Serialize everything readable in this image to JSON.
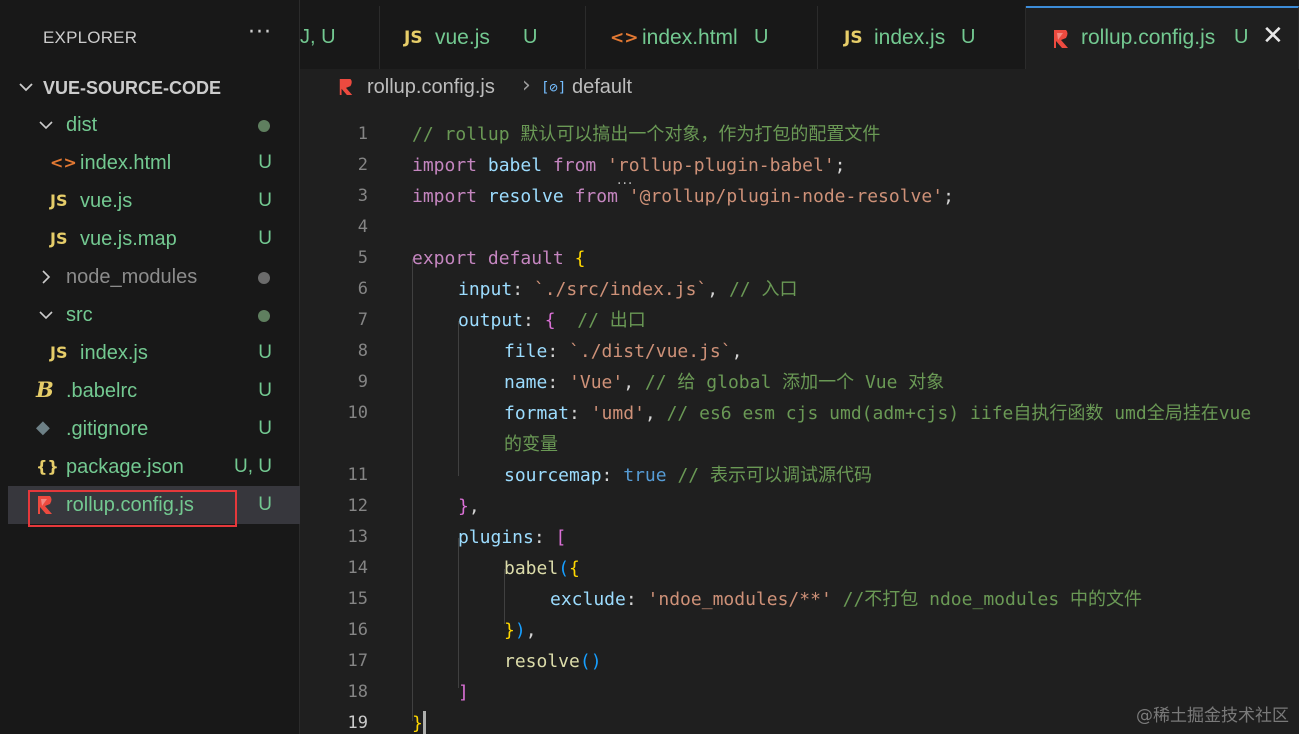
{
  "sidebar": {
    "title": "EXPLORER",
    "more": "···",
    "root": "VUE-SOURCE-CODE",
    "items": [
      {
        "label": "dist",
        "status": ""
      },
      {
        "label": "index.html",
        "status": "U",
        "icon": "<>"
      },
      {
        "label": "vue.js",
        "status": "U",
        "icon": "JS"
      },
      {
        "label": "vue.js.map",
        "status": "U",
        "icon": "JS"
      },
      {
        "label": "node_modules",
        "status": ""
      },
      {
        "label": "src",
        "status": ""
      },
      {
        "label": "index.js",
        "status": "U",
        "icon": "JS"
      },
      {
        "label": ".babelrc",
        "status": "U",
        "icon": "B"
      },
      {
        "label": ".gitignore",
        "status": "U",
        "icon": "◆"
      },
      {
        "label": "package.json",
        "status": "U, U",
        "icon": "{}"
      },
      {
        "label": "rollup.config.js",
        "status": "U",
        "icon": "rollup"
      }
    ]
  },
  "tabs": [
    {
      "label": "",
      "status": "J, U"
    },
    {
      "label": "vue.js",
      "status": "U",
      "icon": "JS"
    },
    {
      "label": "index.html",
      "status": "U",
      "icon": "<>"
    },
    {
      "label": "index.js",
      "status": "U",
      "icon": "JS"
    },
    {
      "label": "rollup.config.js",
      "status": "U",
      "close": "✕"
    }
  ],
  "breadcrumb": {
    "file": "rollup.config.js",
    "separator": "›",
    "symbol_icon": "[⊘]",
    "symbol": "default"
  },
  "editor": {
    "line_numbers": [
      "1",
      "2",
      "3",
      "4",
      "5",
      "6",
      "7",
      "8",
      "9",
      "10",
      "11",
      "12",
      "13",
      "14",
      "15",
      "16",
      "17",
      "18",
      "19"
    ],
    "current_line": "19",
    "lines": {
      "l1": {
        "comment": "// rollup 默认可以搞出一个对象，作为打包的配置文件"
      },
      "l2": {
        "kw1": "import",
        "id": " babel ",
        "kw2": "from",
        "sp": " ",
        "str": "'rollup-plugin-babel'",
        "end": ";"
      },
      "l3": {
        "kw1": "import",
        "id": " resolve ",
        "kw2": "from",
        "sp": " ",
        "str": "'@rollup/plugin-node-resolve'",
        "end": ";"
      },
      "l5": {
        "kw1": "export",
        "kw2": " default",
        "sp": " ",
        "brace": "{"
      },
      "l6": {
        "key": "input",
        "colon": ": ",
        "str": "`./src/index.js`",
        "comma": ", ",
        "comment": "// 入口"
      },
      "l7": {
        "key": "output",
        "colon": ": ",
        "brace": "{",
        "sp": "  ",
        "comment": "// 出口"
      },
      "l8": {
        "key": "file",
        "colon": ": ",
        "str": "`./dist/vue.js`",
        "comma": ","
      },
      "l9": {
        "key": "name",
        "colon": ": ",
        "str": "'Vue'",
        "comma": ", ",
        "comment": "// 给 global 添加一个 Vue 对象"
      },
      "l10": {
        "key": "format",
        "colon": ": ",
        "str": "'umd'",
        "comma": ", ",
        "comment": "// es6 esm cjs umd(adm+cjs) iife自执行函数 umd全局挂在vue",
        "wrap": "的变量"
      },
      "l11": {
        "key": "sourcemap",
        "colon": ": ",
        "bool": "true",
        "sp": " ",
        "comment": "// 表示可以调试源代码"
      },
      "l12": {
        "brace": "}",
        "comma": ","
      },
      "l13": {
        "key": "plugins",
        "colon": ": ",
        "bracket": "["
      },
      "l14": {
        "fn": "babel",
        "paren": "(",
        "brace": "{"
      },
      "l15": {
        "key": "exclude",
        "colon": ": ",
        "str": "'ndoe_modules/**'",
        "sp": " ",
        "comment": "//不打包 ndoe_modules 中的文件"
      },
      "l16": {
        "brace": "}",
        "paren": ")",
        "comma": ","
      },
      "l17": {
        "fn": "resolve",
        "paren": "()"
      },
      "l18": {
        "bracket": "]"
      },
      "l19": {
        "brace": "}"
      }
    },
    "hover_dots": "..."
  },
  "watermark": "@稀土掘金技术社区",
  "colors": {
    "keyword": "#c586c0",
    "identifier": "#9cdcfe",
    "string": "#ce9178",
    "comment": "#6a9955",
    "untracked": "#73c991",
    "highlight_box": "#e5383b"
  }
}
